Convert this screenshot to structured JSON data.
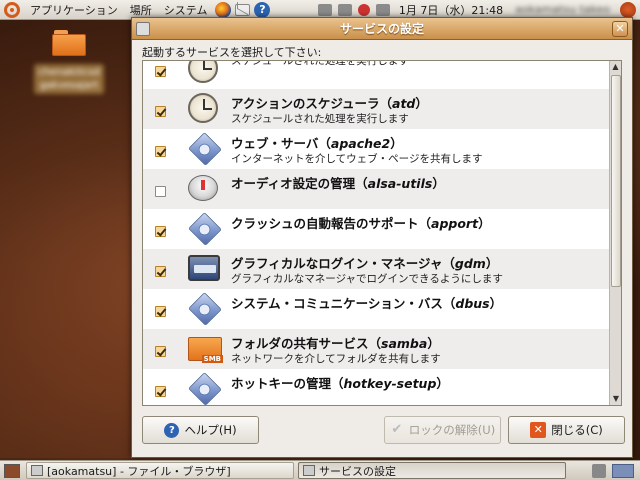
{
  "top_panel": {
    "menus": [
      "アプリケーション",
      "場所",
      "システム"
    ],
    "clock": "1月 7日（水）21:48",
    "user": "aokamatsu takeo"
  },
  "desktop": {
    "folder_label": "chenakiiicsd gakvesajart"
  },
  "dialog": {
    "title": "サービスの設定",
    "instruction": "起動するサービスを選択して下さい:",
    "services": [
      {
        "name": "",
        "italic": "",
        "desc": "スケジュールされた処理を実行します",
        "checked": true,
        "icon": "clock-icon"
      },
      {
        "name": "アクションのスケジューラ（",
        "italic": "atd",
        "desc": "スケジュールされた処理を実行します",
        "checked": true,
        "icon": "clock-icon"
      },
      {
        "name": "ウェブ・サーバ（",
        "italic": "apache2",
        "desc": "インターネットを介してウェブ・ページを共有します",
        "checked": true,
        "icon": "service-gear-icon"
      },
      {
        "name": "オーディオ設定の管理（",
        "italic": "alsa-utils",
        "desc": "",
        "checked": false,
        "icon": "audio-icon"
      },
      {
        "name": "クラッシュの自動報告のサポート（",
        "italic": "apport",
        "desc": "",
        "checked": true,
        "icon": "service-gear-icon"
      },
      {
        "name": "グラフィカルなログイン・マネージャ（",
        "italic": "gdm",
        "desc": "グラフィカルなマネージャでログインできるようにします",
        "checked": true,
        "icon": "login-screen-icon"
      },
      {
        "name": "システム・コミュニケーション・バス（",
        "italic": "dbus",
        "desc": "",
        "checked": true,
        "icon": "service-gear-icon"
      },
      {
        "name": "フォルダの共有サービス（",
        "italic": "samba",
        "desc": "ネットワークを介してフォルダを共有します",
        "checked": true,
        "icon": "samba-folder-icon"
      },
      {
        "name": "ホットキーの管理（",
        "italic": "hotkey-setup",
        "desc": "",
        "checked": true,
        "icon": "service-gear-icon"
      },
      {
        "name": "",
        "italic": "",
        "desc": "",
        "checked": true,
        "icon": "service-gear-icon"
      }
    ],
    "buttons": {
      "help": "ヘルプ(H)",
      "unlock": "ロックの解除(U)",
      "close": "閉じる(C)"
    },
    "samba_badge": "SMB"
  },
  "bottom_panel": {
    "tasks": [
      "[aokamatsu] - ファイル・ブラウザ]",
      "サービスの設定"
    ]
  }
}
